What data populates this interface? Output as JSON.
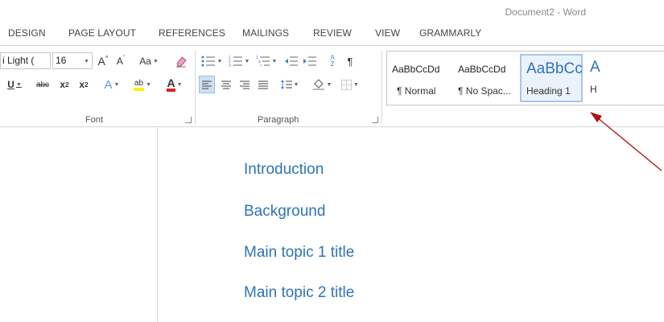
{
  "window": {
    "title": "Document2 - Word"
  },
  "tabs": [
    {
      "label": "DESIGN"
    },
    {
      "label": "PAGE LAYOUT"
    },
    {
      "label": "REFERENCES"
    },
    {
      "label": "MAILINGS"
    },
    {
      "label": "REVIEW"
    },
    {
      "label": "VIEW"
    },
    {
      "label": "GRAMMARLY"
    }
  ],
  "font_group": {
    "label": "Font",
    "font_name": "i Light (",
    "font_size": "16",
    "grow_label": "A",
    "shrink_label": "A",
    "case_label": "Aa",
    "underline_label": "U",
    "strike_label": "abc",
    "subscript_label": "x",
    "subscript_mark": "2",
    "superscript_label": "x",
    "superscript_mark": "2",
    "effects_label": "A",
    "highlight_label": "ab",
    "font_color_label": "A"
  },
  "paragraph_group": {
    "label": "Paragraph",
    "sort_label": "A",
    "sort_sub": "Z",
    "pilcrow": "¶"
  },
  "styles": [
    {
      "sample": "AaBbCcDd",
      "name": "¶ Normal"
    },
    {
      "sample": "AaBbCcDd",
      "name": "¶ No Spac..."
    },
    {
      "sample": "AaBbCc",
      "name": "Heading 1",
      "selected": true
    },
    {
      "sample": "A",
      "name": "H"
    }
  ],
  "document": {
    "headings": [
      "Introduction",
      "Background",
      "Main topic 1 title",
      "Main topic 2 title"
    ]
  },
  "colors": {
    "heading": "#2e74b5",
    "arrow": "#b01010",
    "highlight": "#ffee00",
    "font_color": "#e02020",
    "selected_style_border": "#a9c7e6"
  }
}
